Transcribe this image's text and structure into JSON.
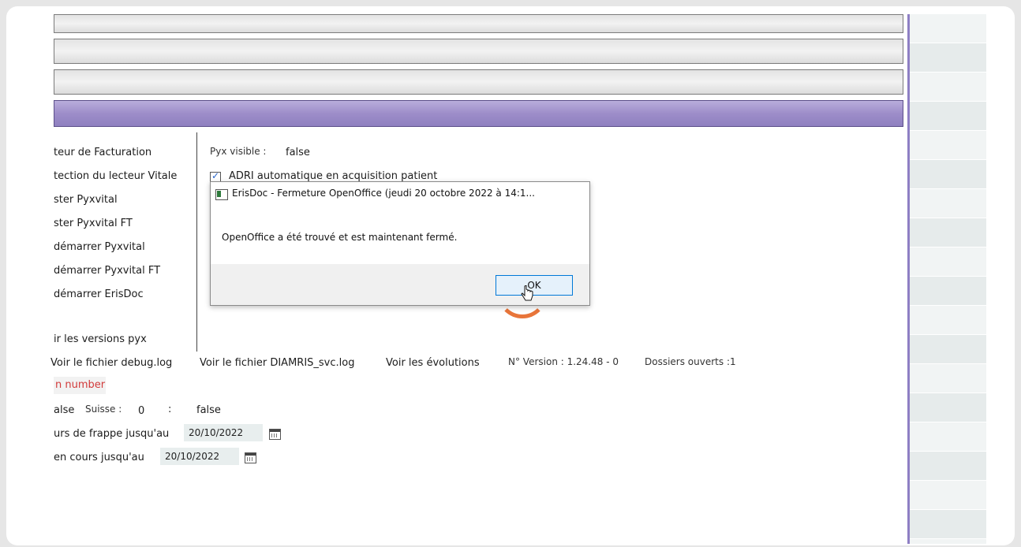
{
  "settings": {
    "labels": [
      "teur de Facturation",
      "tection du lecteur Vitale",
      "ster Pyxvital",
      "ster Pyxvital FT",
      "démarrer Pyxvital",
      "démarrer Pyxvital FT",
      "démarrer ErisDoc",
      "ir les versions pyx"
    ],
    "pyx_visible_label": "Pyx visible :",
    "pyx_visible_value": "false",
    "adri_label": "ADRI automatique en acquisition patient"
  },
  "links": {
    "debug_log": "Voir le fichier debug.log",
    "diamris_log": "Voir le fichier DIAMRIS_svc.log",
    "evolutions": "Voir les évolutions"
  },
  "version_text": "N° Version : 1.24.48 - 0",
  "dossiers_text": "Dossiers ouverts :1",
  "error_text": "n number",
  "suisse": {
    "prefix": "alse",
    "label": "Suisse :",
    "value": "0",
    "colon": ":",
    "value2": "false"
  },
  "dates": {
    "frappe_label": "urs de frappe jusqu'au",
    "frappe_value": "20/10/2022",
    "cours_label": "en cours jusqu'au",
    "cours_value": "20/10/2022"
  },
  "dialog": {
    "title": "ErisDoc - Fermeture OpenOffice (jeudi 20 octobre 2022 à 14:1...",
    "message": "OpenOffice a été trouvé et est maintenant fermé.",
    "ok_label": "OK"
  },
  "colors": {
    "accent_purple": "#9d8dc9",
    "error_red": "#d23a3a",
    "button_blue": "#0078d7",
    "spinner_orange": "#e8753a"
  }
}
